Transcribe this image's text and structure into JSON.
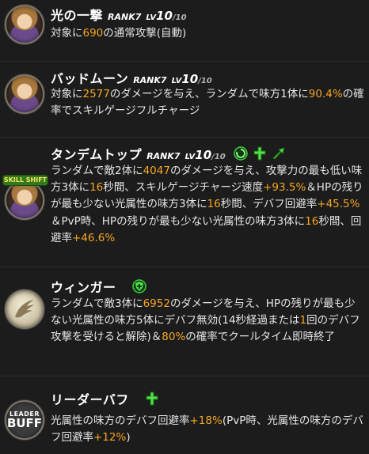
{
  "skills": [
    {
      "name": "光の一撃",
      "rank": "RANK7",
      "lv_label": "LV",
      "lv": "10",
      "lv_max": "/10",
      "icon": "portrait-icon",
      "desc": [
        {
          "t": "対象に"
        },
        {
          "t": "690",
          "hl": true
        },
        {
          "t": "の通常攻撃(自動)"
        }
      ]
    },
    {
      "name": "バッドムーン",
      "rank": "RANK7",
      "lv_label": "LV",
      "lv": "10",
      "lv_max": "/10",
      "icon": "portrait-icon",
      "desc": [
        {
          "t": "対象に"
        },
        {
          "t": "2577",
          "hl": true
        },
        {
          "t": "のダメージを与え、ランダムで味方1体に"
        },
        {
          "t": "90.4%",
          "hl": true
        },
        {
          "t": "の確率でスキルゲージフルチャージ"
        }
      ]
    },
    {
      "name": "タンデムトップ",
      "rank": "RANK7",
      "lv_label": "LV",
      "lv": "10",
      "lv_max": "/10",
      "icon": "portrait-icon",
      "banner": "SKILL SHIFT",
      "effects": [
        "spiral-buff-icon",
        "cross-heal-icon",
        "speed-arrow-icon"
      ],
      "desc": [
        {
          "t": "ランダムで敵2体に"
        },
        {
          "t": "4047",
          "hl": true
        },
        {
          "t": "のダメージを与え、攻撃力の最も低い味方3体に"
        },
        {
          "t": "16",
          "hl": true
        },
        {
          "t": "秒間、スキルゲージチャージ速度"
        },
        {
          "t": "+93.5%",
          "hl": true
        },
        {
          "t": "＆HPの残りが最も少ない光属性の味方3体に"
        },
        {
          "t": "16",
          "hl": true
        },
        {
          "t": "秒間、デバフ回避率"
        },
        {
          "t": "+45.5%",
          "hl": true
        },
        {
          "t": "＆PvP時、HPの残りが最も少ない光属性の味方3体に"
        },
        {
          "t": "16",
          "hl": true
        },
        {
          "t": "秒間、回避率"
        },
        {
          "t": "+46.6%",
          "hl": true
        }
      ]
    },
    {
      "name": "ウィンガー",
      "icon": "wing-icon",
      "effects": [
        "shield-cross-icon"
      ],
      "desc": [
        {
          "t": "ランダムで敵3体に"
        },
        {
          "t": "6952",
          "hl": true
        },
        {
          "t": "のダメージを与え、HPの残りが最も少ない光属性の味方5体にデバフ無効(14秒経過または"
        },
        {
          "t": "1",
          "hl": true
        },
        {
          "t": "回のデバフ攻撃を受けると解除)＆"
        },
        {
          "t": "80%",
          "hl": true
        },
        {
          "t": "の確率でクールタイム即時終了"
        }
      ]
    },
    {
      "name": "リーダーバフ",
      "icon": "leader-buff-icon",
      "icon_text": [
        "LEADER",
        "BUFF"
      ],
      "effects": [
        "cross-heal-icon"
      ],
      "desc": [
        {
          "t": "光属性の味方のデバフ回避率"
        },
        {
          "t": "+18%",
          "hl": true
        },
        {
          "t": "(PvP時、光属性の味方のデバフ回避率"
        },
        {
          "t": "+12%",
          "hl": true
        },
        {
          "t": ")"
        }
      ]
    }
  ],
  "colors": {
    "highlight": "#f5a623",
    "background": "#1c1c1c",
    "effect_green": "#3fcf3a"
  }
}
